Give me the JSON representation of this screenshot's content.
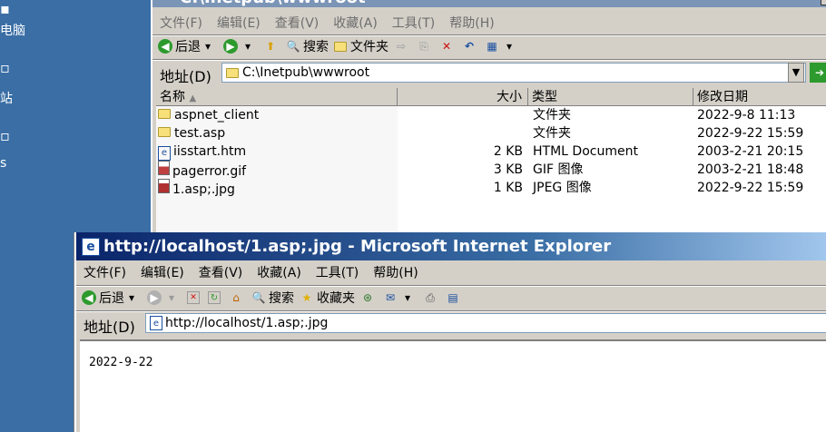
{
  "desktop": {
    "labels": [
      "电脑",
      "站",
      "s"
    ]
  },
  "explorer": {
    "title": "C:\\Inetpub\\wwwroot",
    "menu": [
      "文件(F)",
      "编辑(E)",
      "查看(V)",
      "收藏(A)",
      "工具(T)",
      "帮助(H)"
    ],
    "toolbar": {
      "back": "后退",
      "search": "搜索",
      "folders": "文件夹"
    },
    "address_label": "地址(D)",
    "address_value": "C:\\Inetpub\\wwwroot",
    "columns": [
      "名称",
      "大小",
      "类型",
      "修改日期"
    ],
    "files": [
      {
        "name": "aspnet_client",
        "size": "",
        "type": "文件夹",
        "modified": "2022-9-8 11:13",
        "icon": "folder-icon"
      },
      {
        "name": "test.asp",
        "size": "",
        "type": "文件夹",
        "modified": "2022-9-22 15:59",
        "icon": "folder-icon"
      },
      {
        "name": "iisstart.htm",
        "size": "2 KB",
        "type": "HTML Document",
        "modified": "2003-2-21 20:15",
        "icon": "html-file-icon"
      },
      {
        "name": "pagerror.gif",
        "size": "3 KB",
        "type": "GIF 图像",
        "modified": "2003-2-21 18:48",
        "icon": "gif-file-icon"
      },
      {
        "name": "1.asp;.jpg",
        "size": "1 KB",
        "type": "JPEG 图像",
        "modified": "2022-9-22 15:59",
        "icon": "jpeg-file-icon"
      }
    ]
  },
  "ie": {
    "title": "http://localhost/1.asp;.jpg - Microsoft Internet Explorer",
    "menu": [
      "文件(F)",
      "编辑(E)",
      "查看(V)",
      "收藏(A)",
      "工具(T)",
      "帮助(H)"
    ],
    "toolbar": {
      "back": "后退",
      "search": "搜索",
      "favorites": "收藏夹"
    },
    "address_label": "地址(D)",
    "address_value": "http://localhost/1.asp;.jpg",
    "page_text": "2022-9-22"
  }
}
